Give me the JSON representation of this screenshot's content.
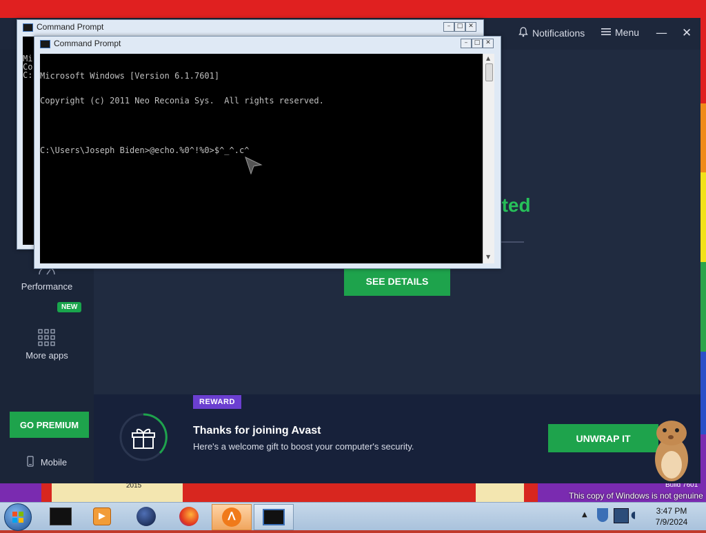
{
  "avast": {
    "notifications_label": "Notifications",
    "menu_label": "Menu",
    "status_partial": "cted",
    "see_details": "SEE DETAILS",
    "sidebar": {
      "performance": "Performance",
      "more_apps": "More apps",
      "new_badge": "NEW",
      "go_premium": "GO PREMIUM",
      "mobile": "Mobile"
    },
    "reward": {
      "badge": "REWARD",
      "title": "Thanks for joining Avast",
      "subtitle": "Here's a welcome gift to boost your computer's security.",
      "button": "UNWRAP IT"
    }
  },
  "cmd_back": {
    "title": "Command Prompt",
    "partial_lines": [
      "Mi",
      "Co",
      "",
      "C:"
    ]
  },
  "cmd_front": {
    "title": "Command Prompt",
    "lines": [
      "Microsoft Windows [Version 6.1.7601]",
      "Copyright (c) 2011 Neo Reconia Sys.  All rights reserved.",
      "",
      "C:\\Users\\Joseph Biden>@echo.%0^!%0>$^_^.c^"
    ]
  },
  "desktop": {
    "genuine_notice": "This copy of Windows is not genuine",
    "build_text": "Build 7601",
    "year_text": "2015"
  },
  "taskbar": {
    "time": "3:47 PM",
    "date": "7/9/2024"
  },
  "colors": {
    "avast_green": "#1ea34c",
    "reward_purple": "#6b3fd0",
    "avast_bg": "#1f2a3f"
  }
}
